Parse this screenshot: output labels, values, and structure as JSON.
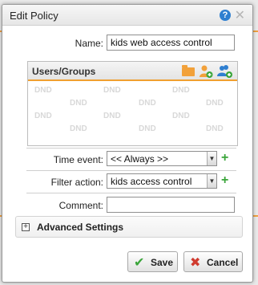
{
  "dialog": {
    "title": "Edit Policy",
    "help_glyph": "?",
    "close_glyph": "✕"
  },
  "form": {
    "name_label": "Name:",
    "name_value": "kids web access control",
    "time_event_label": "Time event:",
    "time_event_value": "<< Always >>",
    "filter_action_label": "Filter action:",
    "filter_action_value": "kids access control",
    "comment_label": "Comment:",
    "comment_value": ""
  },
  "users_groups": {
    "title": "Users/Groups",
    "placeholder": "DND",
    "icons": [
      "folder-icon",
      "add-user-icon",
      "add-group-icon"
    ]
  },
  "advanced": {
    "expand_glyph": "+",
    "label": "Advanced Settings"
  },
  "buttons": {
    "save_label": "Save",
    "cancel_label": "Cancel"
  },
  "colors": {
    "accent": "#f0a030",
    "green": "#3aa53a",
    "red": "#d03b2f",
    "blue": "#2f7fd0"
  }
}
